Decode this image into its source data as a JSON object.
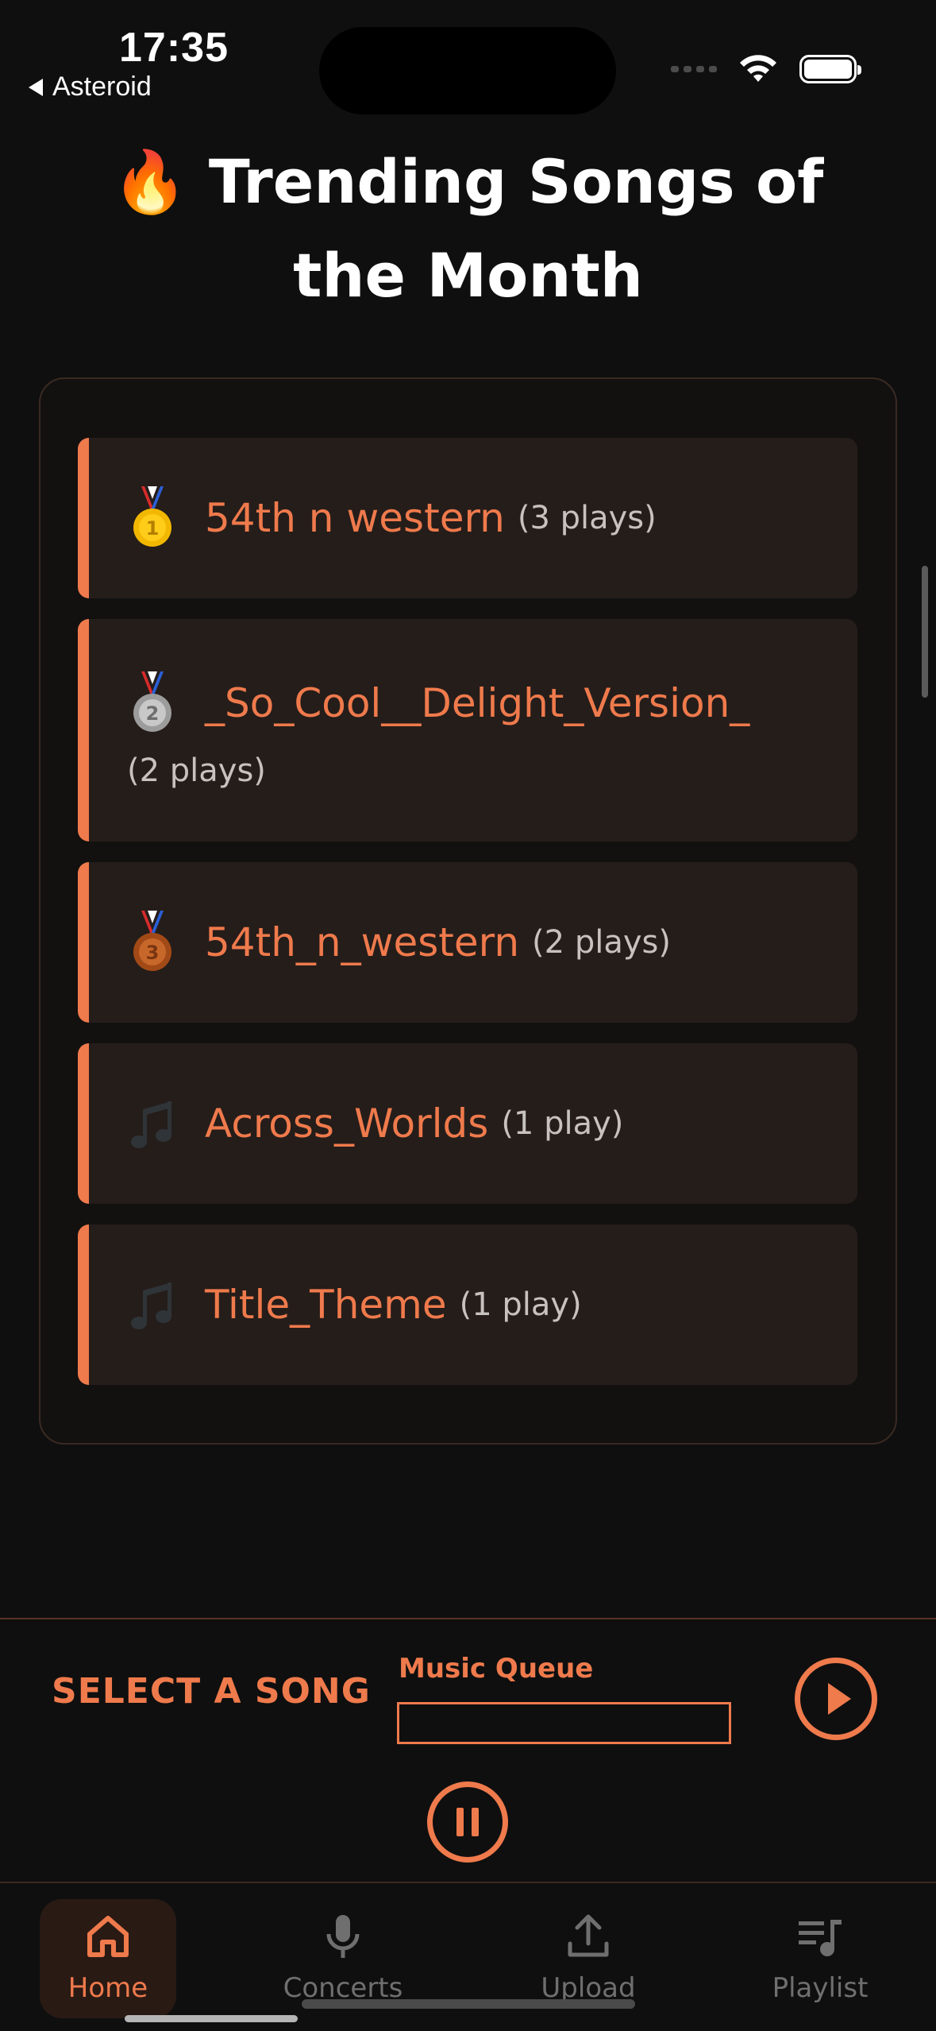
{
  "status_bar": {
    "time": "17:35",
    "back_app": "Asteroid",
    "icons": [
      "signal-icon",
      "wifi-icon",
      "battery-icon"
    ]
  },
  "page": {
    "title_emoji": "🔥",
    "title": "Trending Songs of the Month"
  },
  "songs": [
    {
      "rank_icon": "gold-medal-icon",
      "title": "54th n western",
      "plays": "(3 plays)"
    },
    {
      "rank_icon": "silver-medal-icon",
      "title": "_So_Cool__Delight_Version_",
      "plays": "(2 plays)"
    },
    {
      "rank_icon": "bronze-medal-icon",
      "title": "54th_n_western",
      "plays": "(2 plays)"
    },
    {
      "rank_icon": "music-notes-icon",
      "title": "Across_Worlds",
      "plays": "(1 play)"
    },
    {
      "rank_icon": "music-notes-icon",
      "title": "Title_Theme",
      "plays": "(1 play)"
    }
  ],
  "player": {
    "now_playing": "SELECT A SONG",
    "queue_label": "Music Queue",
    "queue_value": ""
  },
  "nav": {
    "tabs": [
      {
        "label": "Home",
        "icon": "home-icon",
        "active": true
      },
      {
        "label": "Concerts",
        "icon": "microphone-icon",
        "active": false
      },
      {
        "label": "Upload",
        "icon": "upload-icon",
        "active": false
      },
      {
        "label": "Playlist",
        "icon": "playlist-icon",
        "active": false
      }
    ]
  },
  "colors": {
    "accent": "#ef7a4c",
    "background": "#0f0f0f",
    "card": "#251d1a",
    "muted": "#6f6f6f"
  }
}
